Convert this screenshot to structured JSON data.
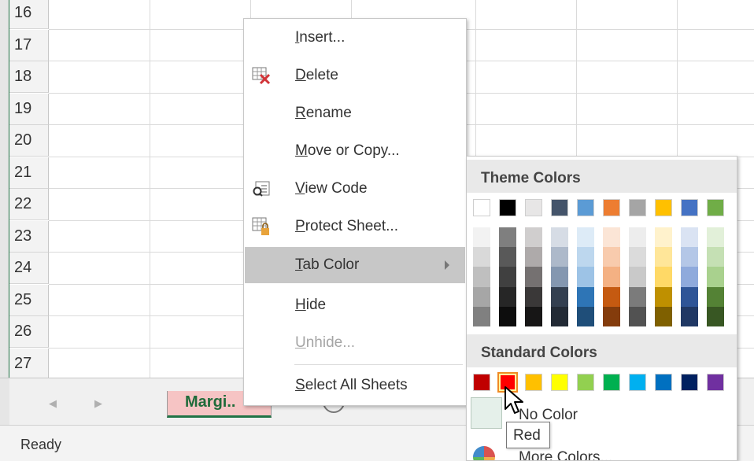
{
  "grid": {
    "row_numbers": [
      "16",
      "17",
      "18",
      "19",
      "20",
      "21",
      "22",
      "23",
      "24",
      "25",
      "26",
      "27"
    ]
  },
  "sheet_tab": {
    "label": "Margi..",
    "color": "#f6c4c4",
    "accent": "#217346"
  },
  "nav": {
    "prev": "◀",
    "next": "▶",
    "add": "+"
  },
  "status": {
    "text": "Ready"
  },
  "context_menu": {
    "items": [
      {
        "label": "Insert...",
        "underline": "I",
        "icon": null,
        "enabled": true
      },
      {
        "label": "Delete",
        "underline": "D",
        "icon": "delete-sheet-icon",
        "enabled": true
      },
      {
        "label": "Rename",
        "underline": "R",
        "icon": null,
        "enabled": true
      },
      {
        "label": "Move or Copy...",
        "underline": "M",
        "icon": null,
        "enabled": true
      },
      {
        "label": "View Code",
        "underline": "V",
        "icon": "view-code-icon",
        "enabled": true
      },
      {
        "label": "Protect Sheet...",
        "underline": "P",
        "icon": "protect-sheet-icon",
        "enabled": true
      },
      {
        "label": "Tab Color",
        "underline": "T",
        "icon": null,
        "enabled": true,
        "highlighted": true,
        "submenu": true
      },
      {
        "label": "Hide",
        "underline": "H",
        "icon": null,
        "enabled": true
      },
      {
        "label": "Unhide...",
        "underline": "U",
        "icon": null,
        "enabled": false
      },
      {
        "label": "Select All Sheets",
        "underline": "S",
        "icon": null,
        "enabled": true
      }
    ]
  },
  "palette": {
    "theme_header": "Theme Colors",
    "standard_header": "Standard Colors",
    "theme_base": [
      "#ffffff",
      "#000000",
      "#e7e6e6",
      "#44546a",
      "#5b9bd5",
      "#ed7d31",
      "#a5a5a5",
      "#ffc000",
      "#4472c4",
      "#70ad47"
    ],
    "theme_tints": [
      [
        "#f2f2f2",
        "#d9d9d9",
        "#bfbfbf",
        "#a6a6a6",
        "#808080"
      ],
      [
        "#7f7f7f",
        "#595959",
        "#404040",
        "#262626",
        "#0d0d0d"
      ],
      [
        "#d0cece",
        "#aeaaaa",
        "#757171",
        "#3a3838",
        "#171616"
      ],
      [
        "#d6dce5",
        "#adb9ca",
        "#8497b0",
        "#333f50",
        "#222a35"
      ],
      [
        "#ddebf7",
        "#bdd7ee",
        "#9dc3e6",
        "#2e75b6",
        "#1f4e79"
      ],
      [
        "#fbe5d6",
        "#f8cbad",
        "#f4b183",
        "#c55a11",
        "#843c0c"
      ],
      [
        "#ededed",
        "#dbdbdb",
        "#c9c9c9",
        "#7b7b7b",
        "#525252"
      ],
      [
        "#fff2cc",
        "#ffe699",
        "#ffd966",
        "#bf9000",
        "#7f6000"
      ],
      [
        "#dae3f3",
        "#b4c7e7",
        "#8faadc",
        "#2f5597",
        "#203864"
      ],
      [
        "#e2f0d9",
        "#c5e0b4",
        "#a9d18e",
        "#548235",
        "#385723"
      ]
    ],
    "standard": [
      "#c00000",
      "#ff0000",
      "#ffc000",
      "#ffff00",
      "#92d050",
      "#00b050",
      "#00b0f0",
      "#0070c0",
      "#002060",
      "#7030a0"
    ],
    "selected_standard_index": 1,
    "no_color_label": "No Color",
    "more_colors_label": "More Colors..."
  },
  "tooltip": {
    "text": "Red"
  }
}
